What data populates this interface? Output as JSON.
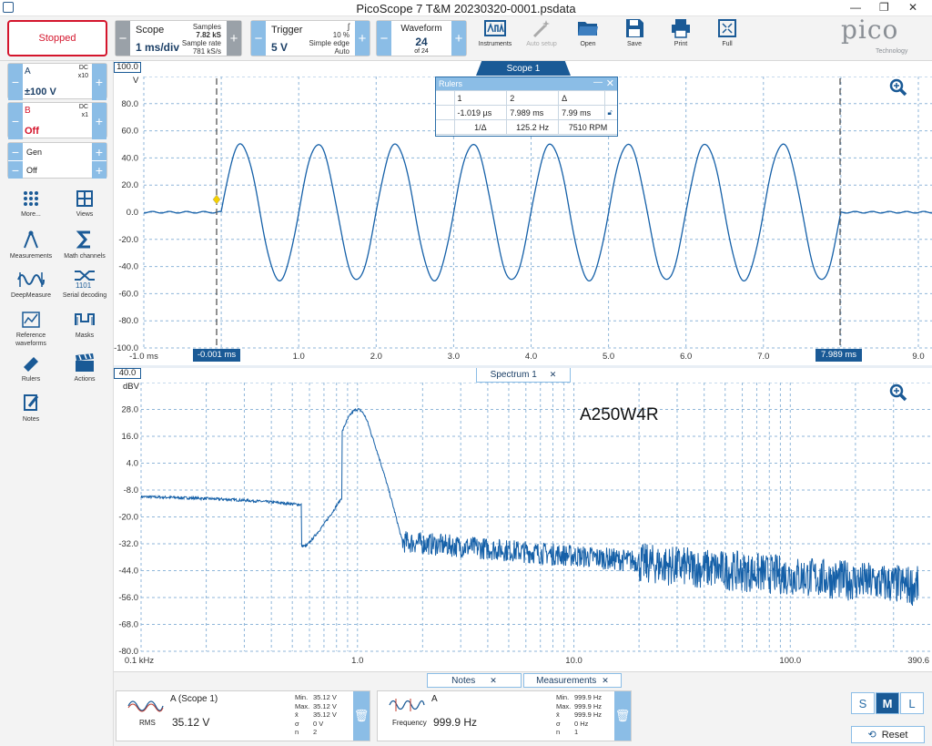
{
  "window": {
    "title": "PicoScope 7 T&M 20230320-0001.psdata"
  },
  "toolbar": {
    "run_state": "Stopped",
    "scope": {
      "label": "Scope",
      "value": "1 ms/div",
      "samples_label": "Samples",
      "samples": "7.82 kS",
      "rate_label": "Sample rate",
      "rate": "781 kS/s"
    },
    "trigger": {
      "label": "Trigger",
      "value": "5 V",
      "percent": "10 %",
      "mode": "Simple edge",
      "auto": "Auto"
    },
    "waveform": {
      "label": "Waveform",
      "value": "24",
      "of": "of 24"
    },
    "buttons": {
      "instruments": "Instruments",
      "auto_setup": "Auto setup",
      "open": "Open",
      "save": "Save",
      "print": "Print",
      "full": "Full"
    },
    "logo": {
      "brand": "pico",
      "sub": "Technology"
    }
  },
  "channels": {
    "a": {
      "name": "A",
      "coupling": "DC",
      "probe": "x10",
      "range": "±100 V"
    },
    "b": {
      "name": "B",
      "coupling": "DC",
      "probe": "x1",
      "state": "Off"
    },
    "gen": {
      "name": "Gen",
      "state": "Off"
    }
  },
  "tools": [
    {
      "label": "More..."
    },
    {
      "label": "Views"
    },
    {
      "label": "Measurements"
    },
    {
      "label": "Math channels"
    },
    {
      "label": "DeepMeasure"
    },
    {
      "label": "Serial decoding"
    },
    {
      "label": "Reference waveforms"
    },
    {
      "label": "Masks"
    },
    {
      "label": "Rulers"
    },
    {
      "label": "Actions"
    },
    {
      "label": "Notes"
    }
  ],
  "scope_view": {
    "tab": "Scope 1",
    "y_unit": "V",
    "y_top_label": "100.0",
    "y_ticks": [
      "80.0",
      "60.0",
      "40.0",
      "20.0",
      "0.0",
      "-20.0",
      "-40.0",
      "-60.0",
      "-80.0",
      "-100.0"
    ],
    "x_ticks": [
      "-1.0 ms",
      "1.0",
      "2.0",
      "3.0",
      "4.0",
      "5.0",
      "6.0",
      "7.0",
      "9.0"
    ],
    "ruler1": "-0.001 ms",
    "ruler2": "7.989 ms"
  },
  "rulers": {
    "title": "Rulers",
    "col1": "1",
    "col2": "2",
    "col3": "Δ",
    "v1": "-1.019 µs",
    "v2": "7.989 ms",
    "vd": "7.99 ms",
    "inv_label": "1/Δ",
    "freq": "125.2 Hz",
    "rpm": "7510 RPM"
  },
  "spectrum_view": {
    "tab": "Spectrum 1",
    "y_unit": "dBV",
    "y_top_label": "40.0",
    "y_ticks": [
      "28.0",
      "16.0",
      "4.0",
      "-8.0",
      "-20.0",
      "-32.0",
      "-44.0",
      "-56.0",
      "-68.0",
      "-80.0"
    ],
    "x_ticks": [
      "0.1 kHz",
      "1.0",
      "10.0",
      "100.0",
      "390.6"
    ],
    "annotation": "A250W4R"
  },
  "bottom": {
    "tab_notes": "Notes",
    "tab_measurements": "Measurements",
    "m1": {
      "source": "A (Scope 1)",
      "type": "RMS",
      "value": "35.12 V",
      "min_l": "Min.",
      "min": "35.12 V",
      "max_l": "Max.",
      "max": "35.12 V",
      "avg_l": "x̄",
      "avg": "35.12 V",
      "sd_l": "σ",
      "sd": "0 V",
      "n_l": "n",
      "n": "2"
    },
    "m2": {
      "source": "A",
      "type": "Frequency",
      "value": "999.9 Hz",
      "min_l": "Min.",
      "min": "999.9 Hz",
      "max_l": "Max.",
      "max": "999.9 Hz",
      "avg_l": "x̄",
      "avg": "999.9 Hz",
      "sd_l": "σ",
      "sd": "0 Hz",
      "n_l": "n",
      "n": "1"
    },
    "size_s": "S",
    "size_m": "M",
    "size_l": "L",
    "reset": "Reset"
  },
  "colors": {
    "accent": "#1a5a96",
    "trace": "#1560a8",
    "stop": "#d4152c",
    "grid": "#8fb6d9"
  }
}
